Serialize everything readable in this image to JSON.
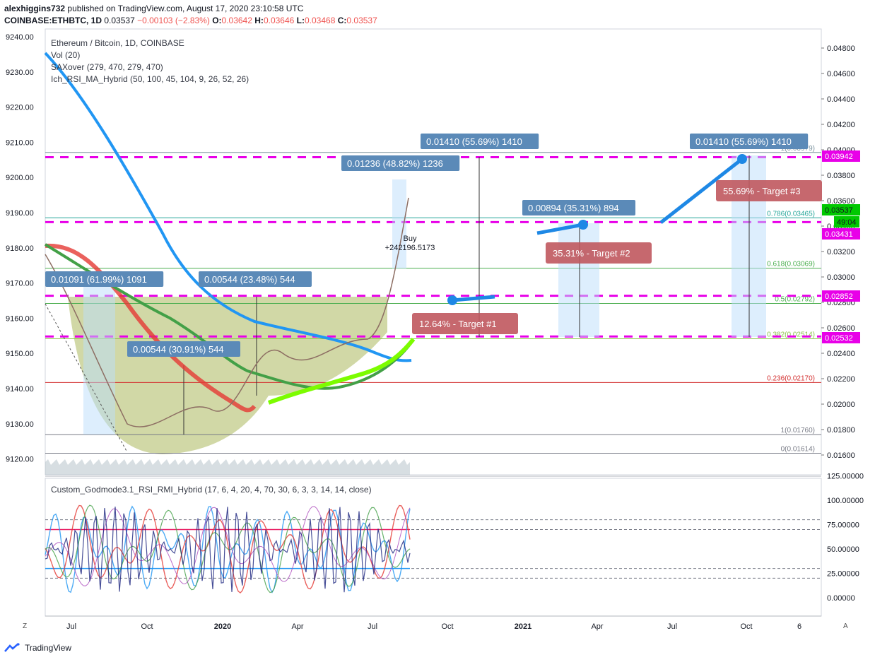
{
  "header": {
    "author": "alexhiggins732",
    "published_text": "published on TradingView.com, August 17, 2020 23:10:58 UTC",
    "symbol_line": "COINBASE:ETHBTC, 1D",
    "last": "0.03537",
    "change": "−0.00103 (−2.83%)",
    "open_label": "O:",
    "open": "0.03642",
    "high_label": "H:",
    "high": "0.03646",
    "low_label": "L:",
    "low": "0.03468",
    "close_label": "C:",
    "close": "0.03537"
  },
  "legend": {
    "title": "Ethereum / Bitcoin, 1D, COINBASE",
    "vol": "Vol (20)",
    "saxover": "SAXover (279, 470, 279, 470)",
    "hybrid": "Ich_RSI_MA_Hybrid (50, 100, 45, 104, 9, 26, 52, 26)",
    "oscillator": "Custom_Godmode3.1_RSI_RMI_Hybrid (17, 6, 4, 20, 4, 70, 30, 6, 3, 3, 14, 14, close)"
  },
  "footer": {
    "brand": "TradingView"
  },
  "buttons": {
    "zoom_left": "Z",
    "auto_right": "A"
  },
  "colors": {
    "target_line": "#e800e8",
    "price_badge": "#00c800",
    "measure_box": "#5b8ab8",
    "target_callout": "#c0585e",
    "arrow": "#1e88e5",
    "ma_blue": "#2196f3",
    "ma_red": "#e53935",
    "ma_green": "#43a047",
    "cup_fill": "#9aa83a"
  },
  "chart_data": [
    {
      "type": "line",
      "title": "Ethereum / Bitcoin, 1D, COINBASE",
      "x_ticks": [
        "Jul",
        "Oct",
        "2020",
        "Apr",
        "Jul",
        "Oct",
        "2021",
        "Apr",
        "Jul",
        "Oct",
        "6"
      ],
      "left_axis_ticks": [
        "9240.00",
        "9230.00",
        "9220.00",
        "9210.00",
        "9200.00",
        "9190.00",
        "9180.00",
        "9170.00",
        "9160.00",
        "9150.00",
        "9140.00",
        "9130.00",
        "9120.00"
      ],
      "right_axis_ticks": [
        "0.04800",
        "0.04600",
        "0.04400",
        "0.04200",
        "0.04000",
        "0.03800",
        "0.03600",
        "0.03400",
        "0.03200",
        "0.03000",
        "0.02800",
        "0.02600",
        "0.02400",
        "0.02200",
        "0.02000",
        "0.01800",
        "0.01600"
      ],
      "price_badges": [
        {
          "label": "0.03942",
          "kind": "target"
        },
        {
          "label": "0.03537",
          "kind": "last"
        },
        {
          "label": "49:04",
          "kind": "countdown"
        },
        {
          "label": "0.03431",
          "kind": "target"
        },
        {
          "label": "0.02852",
          "kind": "target"
        },
        {
          "label": "0.02532",
          "kind": "target"
        }
      ],
      "fibonacci": [
        {
          "label": "1(0.03979)",
          "value": 0.03979
        },
        {
          "label": "0.786(0.03465)",
          "value": 0.03465
        },
        {
          "label": "0.618(0.03069)",
          "value": 0.03069
        },
        {
          "label": "0.5(0.02792)",
          "value": 0.02792
        },
        {
          "label": "0.382(0.02514)",
          "value": 0.02514
        },
        {
          "label": "0.236(0.02170)",
          "value": 0.0217
        },
        {
          "label": "1(0.01760)",
          "value": 0.0176
        },
        {
          "label": "0(0.01614)",
          "value": 0.01614
        }
      ],
      "measurements": [
        {
          "label": "0.01091 (61.99%) 1091"
        },
        {
          "label": "0.00544 (23.48%) 544"
        },
        {
          "label": "0.00544 (30.91%) 544"
        },
        {
          "label": "0.01236 (48.82%) 1236"
        },
        {
          "label": "0.01410 (55.69%) 1410"
        },
        {
          "label": "0.00894 (35.31%) 894"
        },
        {
          "label": "0.01410 (55.69%) 1410"
        }
      ],
      "targets": [
        {
          "label": "12.64% - Target #1"
        },
        {
          "label": "35.31% - Target #2"
        },
        {
          "label": "55.69% - Target #3"
        }
      ],
      "signal": {
        "label1": "Buy",
        "label2": "+242196.5173"
      }
    },
    {
      "type": "line",
      "title": "Custom_Godmode3.1_RSI_RMI_Hybrid (17, 6, 4, 20, 4, 70, 30, 6, 3, 3, 14, 14, close)",
      "y_ticks": [
        "125.00000",
        "100.00000",
        "75.00000",
        "50.00000",
        "25.00000",
        "0.00000"
      ],
      "ylim": [
        -10,
        125
      ],
      "levels": [
        80,
        70,
        30,
        20
      ]
    }
  ]
}
